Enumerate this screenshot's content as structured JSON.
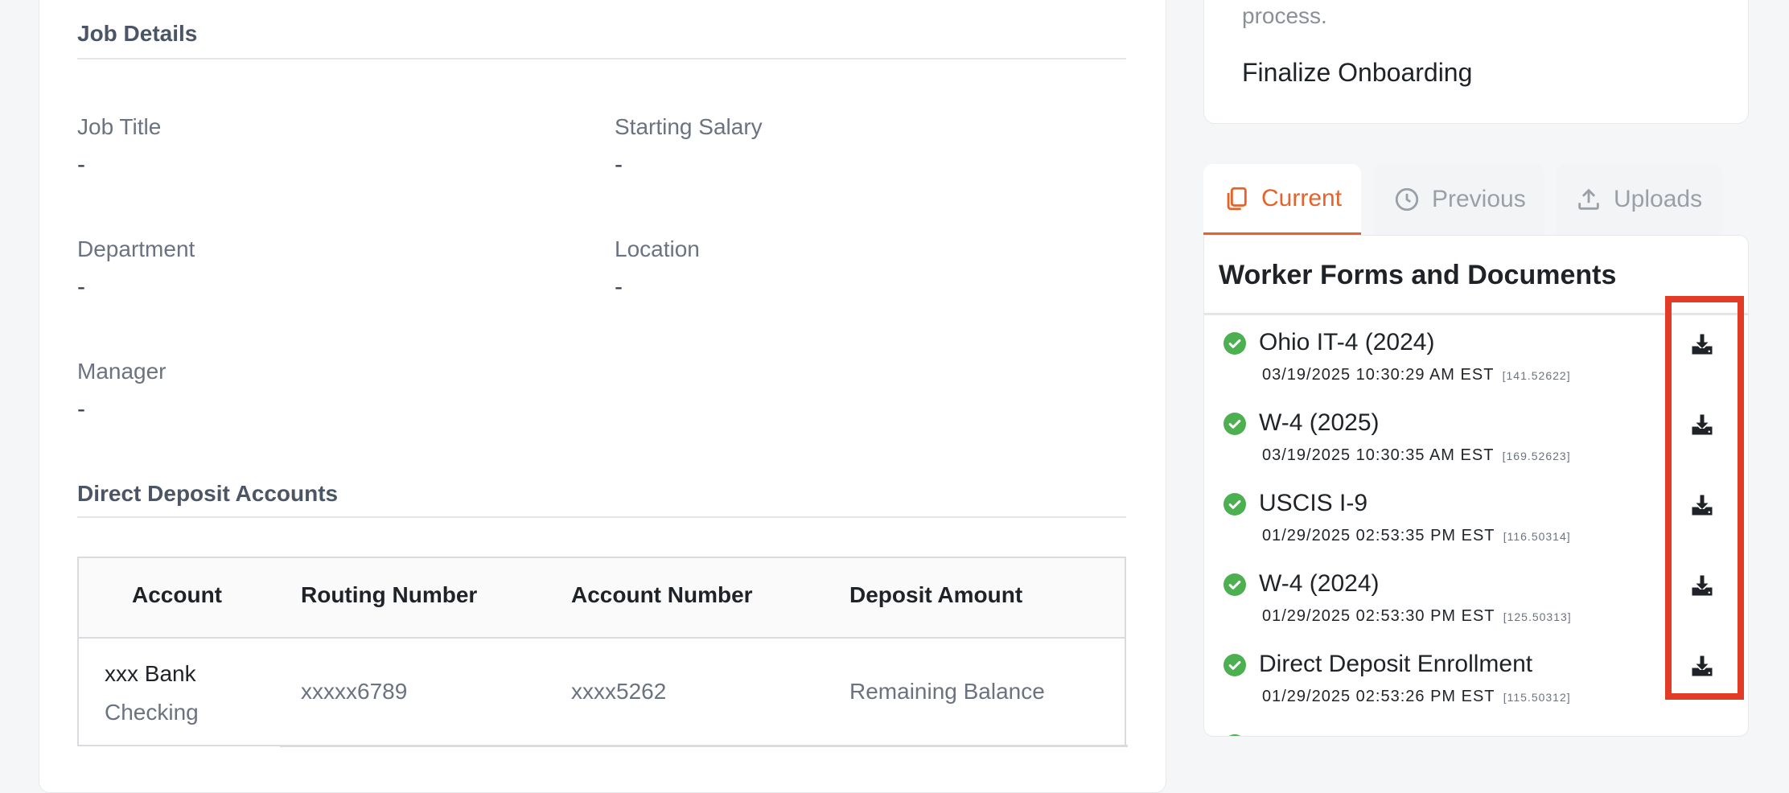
{
  "job_details": {
    "title": "Job Details",
    "fields": {
      "job_title": {
        "label": "Job Title",
        "value": "-"
      },
      "starting_salary": {
        "label": "Starting Salary",
        "value": "-"
      },
      "department": {
        "label": "Department",
        "value": "-"
      },
      "location": {
        "label": "Location",
        "value": "-"
      },
      "manager": {
        "label": "Manager",
        "value": "-"
      }
    }
  },
  "direct_deposit": {
    "title": "Direct Deposit Accounts",
    "columns": [
      "Account",
      "Routing Number",
      "Account Number",
      "Deposit Amount"
    ],
    "rows": [
      {
        "bank": "xxx Bank",
        "type": "Checking",
        "routing": "xxxxx6789",
        "account": "xxxx5262",
        "amount": "Remaining Balance"
      }
    ]
  },
  "onboarding": {
    "process_text": "process.",
    "finalize_label": "Finalize Onboarding"
  },
  "tabs": [
    {
      "label": "Current",
      "icon": "copy-icon",
      "active": true
    },
    {
      "label": "Previous",
      "icon": "clock-icon",
      "active": false
    },
    {
      "label": "Uploads",
      "icon": "upload-icon",
      "active": false
    }
  ],
  "documents": {
    "title": "Worker Forms and Documents",
    "items": [
      {
        "name": "Ohio IT-4 (2024)",
        "date": "03/19/2025 10:30:29 AM EST",
        "code": "[141.52622]"
      },
      {
        "name": "W-4 (2025)",
        "date": "03/19/2025 10:30:35 AM EST",
        "code": "[169.52623]"
      },
      {
        "name": "USCIS I-9",
        "date": "01/29/2025 02:53:35 PM EST",
        "code": "[116.50314]"
      },
      {
        "name": "W-4 (2024)",
        "date": "01/29/2025 02:53:30 PM EST",
        "code": "[125.50313]"
      },
      {
        "name": "Direct Deposit Enrollment",
        "date": "01/29/2025 02:53:26 PM EST",
        "code": "[115.50312]"
      }
    ]
  },
  "colors": {
    "accent": "#e4632a",
    "check": "#4caf50",
    "highlight": "#e23b26"
  }
}
